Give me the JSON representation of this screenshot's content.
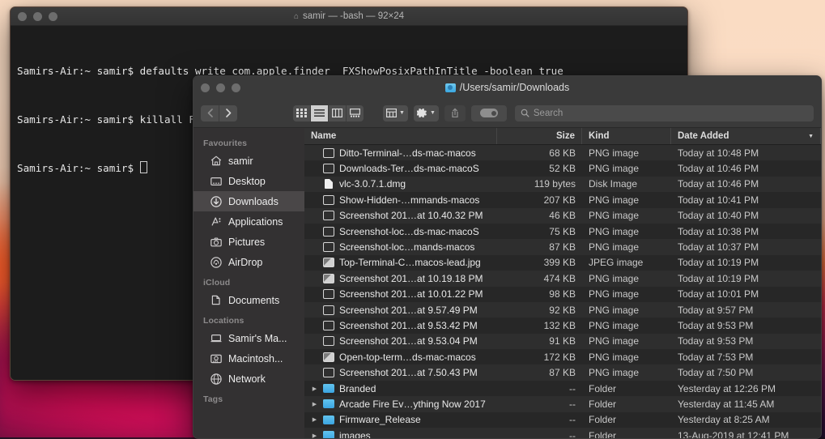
{
  "desktop": {
    "wallpaper_colors": [
      "#fadcc3",
      "#e8703f",
      "#c32d4a",
      "#5b1448",
      "#241030"
    ]
  },
  "terminal": {
    "title": "samir — -bash — 92×24",
    "home_icon": "home-icon",
    "lines": [
      "Samirs-Air:~ samir$ defaults write com.apple.finder _FXShowPosixPathInTitle -boolean true",
      "Samirs-Air:~ samir$ killall Finder",
      "Samirs-Air:~ samir$ "
    ]
  },
  "finder": {
    "title": "/Users/samir/Downloads",
    "title_icon": "blue-folder-icon",
    "toolbar": {
      "back_label": "Back",
      "forward_label": "Forward",
      "view_icon_label": "Icon view",
      "view_list_label": "List view",
      "view_column_label": "Column view",
      "view_gallery_label": "Gallery view",
      "group_label": "Group items",
      "action_label": "Action",
      "share_label": "Share",
      "tags_label": "Tags",
      "search_placeholder": "Search",
      "search_value": ""
    },
    "sidebar": {
      "sections": [
        {
          "label": "Favourites",
          "items": [
            {
              "label": "samir",
              "icon": "house-icon",
              "selected": false
            },
            {
              "label": "Desktop",
              "icon": "desktop-icon",
              "selected": false
            },
            {
              "label": "Downloads",
              "icon": "downloads-arrow-icon",
              "selected": true
            },
            {
              "label": "Applications",
              "icon": "applications-icon",
              "selected": false
            },
            {
              "label": "Pictures",
              "icon": "camera-icon",
              "selected": false
            },
            {
              "label": "AirDrop",
              "icon": "airdrop-icon",
              "selected": false
            }
          ]
        },
        {
          "label": "iCloud",
          "items": [
            {
              "label": "Documents",
              "icon": "documents-icon",
              "selected": false
            }
          ]
        },
        {
          "label": "Locations",
          "items": [
            {
              "label": "Samir's Ma...",
              "icon": "laptop-icon",
              "selected": false
            },
            {
              "label": "Macintosh...",
              "icon": "harddisk-icon",
              "selected": false
            },
            {
              "label": "Network",
              "icon": "network-globe-icon",
              "selected": false
            }
          ]
        },
        {
          "label": "Tags",
          "items": []
        }
      ]
    },
    "columns": {
      "name": "Name",
      "size": "Size",
      "kind": "Kind",
      "date": "Date Added",
      "sort_indicator": "chevron-down-icon"
    },
    "files": [
      {
        "name": "Ditto-Terminal-…ds-mac-macos",
        "size": "68 KB",
        "kind": "PNG image",
        "date": "Today at 10:48 PM",
        "icon": "image-file-icon",
        "expandable": false
      },
      {
        "name": "Downloads-Ter…ds-mac-macoS",
        "size": "52 KB",
        "kind": "PNG image",
        "date": "Today at 10:46 PM",
        "icon": "image-file-icon",
        "expandable": false
      },
      {
        "name": "vlc-3.0.7.1.dmg",
        "size": "119 bytes",
        "kind": "Disk Image",
        "date": "Today at 10:46 PM",
        "icon": "disk-image-icon",
        "expandable": false
      },
      {
        "name": "Show-Hidden-…mmands-macos",
        "size": "207 KB",
        "kind": "PNG image",
        "date": "Today at 10:41 PM",
        "icon": "image-file-icon",
        "expandable": false
      },
      {
        "name": "Screenshot 201…at 10.40.32 PM",
        "size": "46 KB",
        "kind": "PNG image",
        "date": "Today at 10:40 PM",
        "icon": "image-file-icon",
        "expandable": false
      },
      {
        "name": "Screenshot-loc…ds-mac-macoS",
        "size": "75 KB",
        "kind": "PNG image",
        "date": "Today at 10:38 PM",
        "icon": "image-file-icon",
        "expandable": false
      },
      {
        "name": "Screenshot-loc…mands-macos",
        "size": "87 KB",
        "kind": "PNG image",
        "date": "Today at 10:37 PM",
        "icon": "image-file-icon",
        "expandable": false
      },
      {
        "name": "Top-Terminal-C…macos-lead.jpg",
        "size": "399 KB",
        "kind": "JPEG image",
        "date": "Today at 10:19 PM",
        "icon": "photo-file-icon",
        "expandable": false
      },
      {
        "name": "Screenshot 201…at 10.19.18 PM",
        "size": "474 KB",
        "kind": "PNG image",
        "date": "Today at 10:19 PM",
        "icon": "photo-file-icon",
        "expandable": false
      },
      {
        "name": "Screenshot 201…at 10.01.22 PM",
        "size": "98 KB",
        "kind": "PNG image",
        "date": "Today at 10:01 PM",
        "icon": "image-file-icon",
        "expandable": false
      },
      {
        "name": "Screenshot 201…at 9.57.49 PM",
        "size": "92 KB",
        "kind": "PNG image",
        "date": "Today at 9:57 PM",
        "icon": "image-file-icon",
        "expandable": false
      },
      {
        "name": "Screenshot 201…at 9.53.42 PM",
        "size": "132 KB",
        "kind": "PNG image",
        "date": "Today at 9:53 PM",
        "icon": "image-file-icon",
        "expandable": false
      },
      {
        "name": "Screenshot 201…at 9.53.04 PM",
        "size": "91 KB",
        "kind": "PNG image",
        "date": "Today at 9:53 PM",
        "icon": "image-file-icon",
        "expandable": false
      },
      {
        "name": "Open-top-term…ds-mac-macos",
        "size": "172 KB",
        "kind": "PNG image",
        "date": "Today at 7:53 PM",
        "icon": "photo-file-icon",
        "expandable": false
      },
      {
        "name": "Screenshot 201…at 7.50.43 PM",
        "size": "87 KB",
        "kind": "PNG image",
        "date": "Today at 7:50 PM",
        "icon": "image-file-icon",
        "expandable": false
      },
      {
        "name": "Branded",
        "size": "--",
        "kind": "Folder",
        "date": "Yesterday at 12:26 PM",
        "icon": "folder-icon",
        "expandable": true
      },
      {
        "name": "Arcade Fire Ev…ything Now 2017",
        "size": "--",
        "kind": "Folder",
        "date": "Yesterday at 11:45 AM",
        "icon": "folder-icon",
        "expandable": true
      },
      {
        "name": "Firmware_Release",
        "size": "--",
        "kind": "Folder",
        "date": "Yesterday at 8:25 AM",
        "icon": "folder-icon",
        "expandable": true
      },
      {
        "name": "images",
        "size": "--",
        "kind": "Folder",
        "date": "13-Aug-2019 at 12:41 PM",
        "icon": "folder-icon",
        "expandable": true
      }
    ]
  }
}
